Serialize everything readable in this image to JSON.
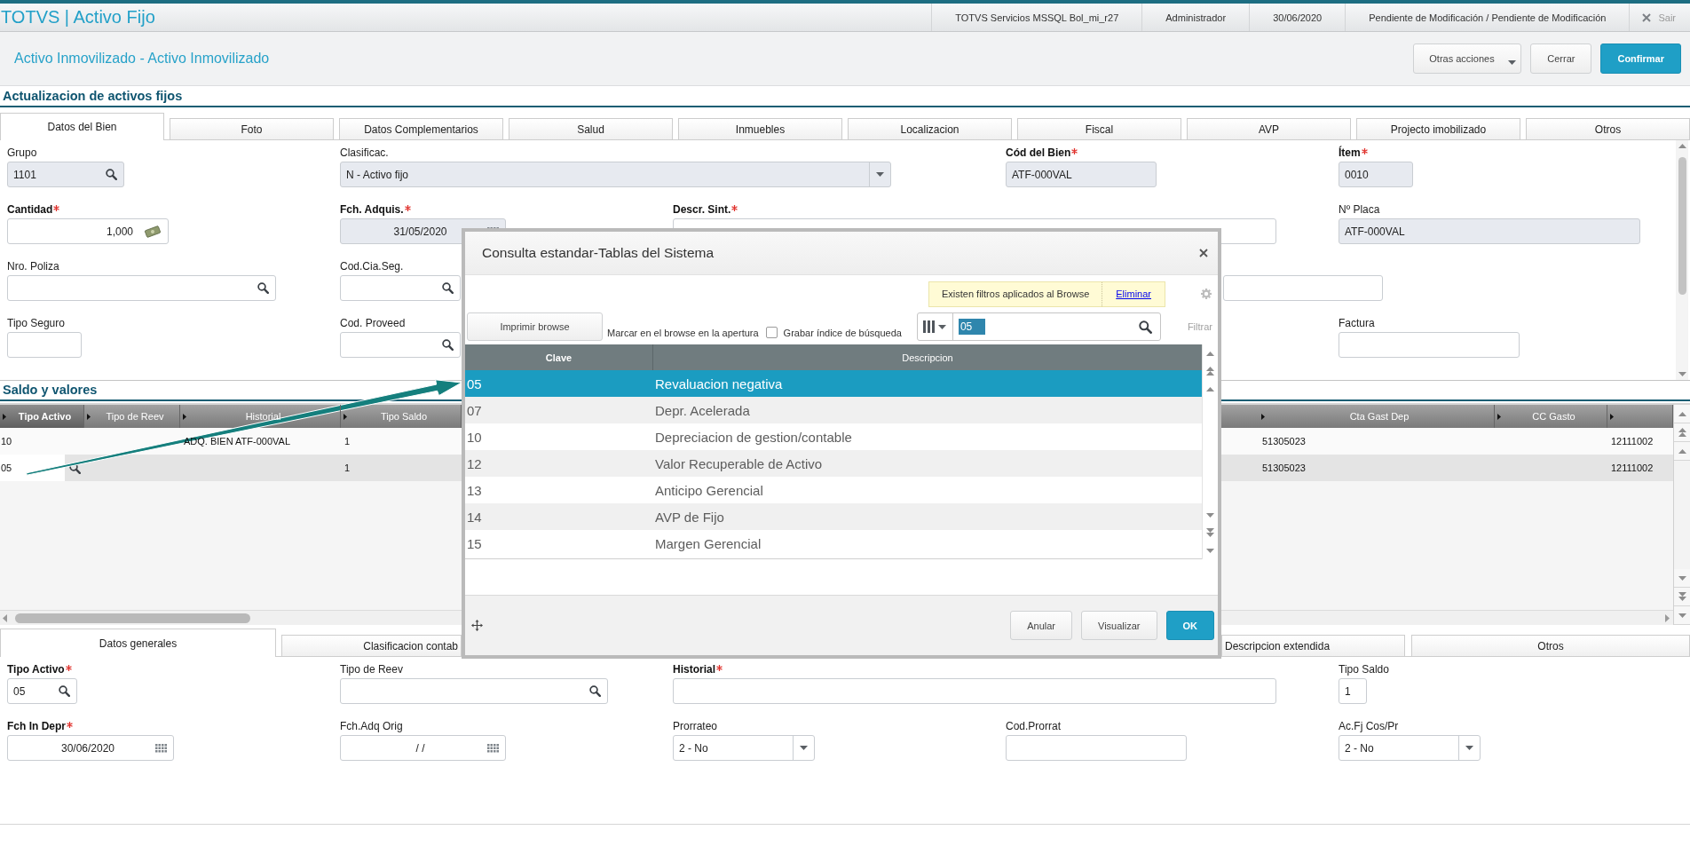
{
  "app_bar": {
    "title": "TOTVS | Activo Fijo",
    "info": [
      "TOTVS Servicios MSSQL Bol_mi_r27",
      "Administrador",
      "30/06/2020",
      "Pendiente de Modificación / Pendiente de Modificación"
    ],
    "exit_label": "Sair"
  },
  "page_header": {
    "title": "Activo Inmovilizado - Activo Inmovilizado",
    "buttons": [
      {
        "label": "Otras acciones",
        "kind": "menu"
      },
      {
        "label": "Cerrar",
        "kind": "default"
      },
      {
        "label": "Confirmar",
        "kind": "primary"
      }
    ]
  },
  "section_title": "Actualizacion de activos fijos",
  "tabs": [
    {
      "label": "Datos del Bien",
      "selected": true
    },
    {
      "label": "Foto",
      "selected": false
    },
    {
      "label": "Datos Complementarios",
      "selected": false
    },
    {
      "label": "Salud",
      "selected": false
    },
    {
      "label": "Inmuebles",
      "selected": false
    },
    {
      "label": "Localizacion",
      "selected": false
    },
    {
      "label": "Fiscal",
      "selected": false
    },
    {
      "label": "AVP",
      "selected": false
    },
    {
      "label": "Projecto imobilizado",
      "selected": false
    },
    {
      "label": "Otros",
      "selected": false
    }
  ],
  "form": {
    "rows": [
      [
        {
          "label": "Grupo",
          "required": false,
          "kind": "lookup",
          "value": "1101",
          "readonly": true
        },
        {
          "label": "Clasificac.",
          "required": false,
          "kind": "select",
          "value": "N - Activo fijo",
          "readonly": true
        },
        null,
        {
          "label": "Cód del Bien",
          "required": true,
          "kind": "text",
          "value": "ATF-000VAL",
          "readonly": true
        },
        {
          "label": "Ítem",
          "required": true,
          "kind": "text",
          "value": "0010",
          "readonly": true
        }
      ],
      [
        {
          "label": "Cantidad",
          "required": true,
          "kind": "amount",
          "value": "1,000",
          "readonly": false
        },
        {
          "label": "Fch. Adquis.",
          "required": true,
          "kind": "date",
          "value": "31/05/2020",
          "readonly": true
        },
        {
          "label": "Descr. Sint.",
          "required": true,
          "kind": "text",
          "readonly": false
        },
        null,
        {
          "label": "Nº Placa",
          "required": false,
          "kind": "text",
          "value": "ATF-000VAL",
          "readonly": true
        }
      ],
      [
        {
          "label": "Nro. Poliza",
          "required": false,
          "kind": "lookup",
          "readonly": false
        },
        {
          "label": "Cod.Cia.Seg.",
          "required": false,
          "kind": "lookup",
          "readonly": false
        },
        null,
        {
          "kind": "text",
          "readonly": false
        },
        null
      ],
      [
        {
          "label": "Tipo Seguro",
          "required": false,
          "kind": "text",
          "readonly": false
        },
        {
          "label": "Cod. Proveed",
          "required": false,
          "kind": "lookup",
          "readonly": false
        },
        null,
        null,
        {
          "label": "Factura",
          "required": false,
          "kind": "text",
          "readonly": false
        }
      ]
    ]
  },
  "balances": {
    "title": "Saldo y valores",
    "grid": {
      "columns": [
        {
          "label": "Tipo Activo",
          "selected": true
        },
        {
          "label": "Tipo de Reev",
          "selected": false
        },
        {
          "label": "Historial",
          "selected": false
        },
        {
          "label": "Tipo Saldo",
          "selected": false
        },
        {
          "label": "Cta Gast Dep",
          "selected": false
        },
        {
          "label": "CC Gasto",
          "selected": false
        },
        {
          "selected": false
        }
      ],
      "rows": [
        {
          "selected": false,
          "editing": false,
          "cells": [
            "10",
            null,
            "ADQ. BIEN ATF-000VAL",
            "1",
            "51305023",
            null,
            "12111002"
          ]
        },
        {
          "selected": true,
          "editing": true,
          "cells": [
            "05",
            null,
            null,
            "1",
            "51305023",
            null,
            "12111002"
          ]
        }
      ]
    }
  },
  "detail_tabs": [
    {
      "label": "Datos generales",
      "selected": true
    },
    {
      "label": "Clasificacion contab",
      "selected": false
    },
    {
      "label": "Descripcion extendida",
      "selected": false
    },
    {
      "label": "Otros",
      "selected": false
    }
  ],
  "detail_form": {
    "rows": [
      [
        {
          "label": "Tipo Activo",
          "required": true,
          "kind": "lookup",
          "value": "05",
          "readonly": false
        },
        {
          "label": "Tipo de Reev",
          "required": false,
          "kind": "lookup",
          "readonly": false
        },
        {
          "label": "Historial",
          "required": true,
          "kind": "text",
          "readonly": false
        },
        null,
        {
          "label": "Tipo Saldo",
          "required": false,
          "kind": "text",
          "value": "1",
          "readonly": false
        }
      ],
      [
        {
          "label": "Fch In Depr",
          "required": true,
          "kind": "date",
          "value": "30/06/2020",
          "readonly": false
        },
        {
          "label": "Fch.Adq Orig",
          "required": false,
          "kind": "date",
          "value": "/ /",
          "readonly": false
        },
        {
          "label": "Prorrateo",
          "required": false,
          "kind": "select",
          "value": "2 - No",
          "readonly": false
        },
        {
          "label": "Cod.Prorrat",
          "required": false,
          "kind": "text",
          "readonly": false
        },
        {
          "label": "Ac.Fj Cos/Pr",
          "required": false,
          "kind": "select",
          "value": "2 - No",
          "readonly": false
        }
      ]
    ]
  },
  "dialog": {
    "title": "Consulta estandar-Tablas del Sistema",
    "filter_notice": "Existen filtros aplicados al Browse",
    "filter_link": "Eliminar",
    "print_button": "Imprimir browse",
    "mark_label": "Marcar en el browse en la apertura",
    "index_option": {
      "label": "Grabar índice de búsqueda",
      "checked": false
    },
    "search": {
      "value": "05",
      "value_selected": true
    },
    "filter_button": "Filtrar",
    "table": {
      "columns": [
        {
          "label": "Clave",
          "selected": true
        },
        {
          "label": "Descripcion",
          "selected": false
        }
      ],
      "rows": [
        {
          "cells": [
            "05",
            "Revaluacion negativa"
          ],
          "selected": true
        },
        {
          "cells": [
            "07",
            "Depr. Acelerada"
          ],
          "selected": false
        },
        {
          "cells": [
            "10",
            "Depreciacion de gestion/contable"
          ],
          "selected": false
        },
        {
          "cells": [
            "12",
            "Valor Recuperable de Activo"
          ],
          "selected": false
        },
        {
          "cells": [
            "13",
            "Anticipo Gerencial"
          ],
          "selected": false
        },
        {
          "cells": [
            "14",
            "AVP de Fijo"
          ],
          "selected": false
        },
        {
          "cells": [
            "15",
            "Margen Gerencial"
          ],
          "selected": false
        }
      ]
    },
    "buttons": [
      {
        "label": "Anular",
        "kind": "default"
      },
      {
        "label": "Visualizar",
        "kind": "default"
      },
      {
        "label": "OK",
        "kind": "primary"
      }
    ]
  }
}
